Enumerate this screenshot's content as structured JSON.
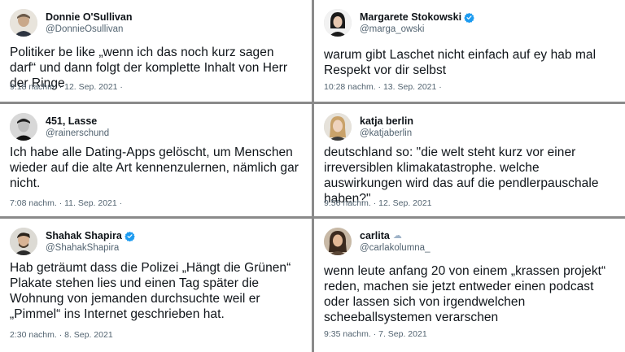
{
  "tweets": [
    {
      "name": "Donnie O'Sullivan",
      "handle": "@DonnieOsullivan",
      "verified": false,
      "text": "Politiker be like „wenn ich das noch kurz sagen darf“ und dann folgt der komplette Inhalt von Herr der Ringe",
      "meta": "9:18 nachm. · 12. Sep. 2021 ·"
    },
    {
      "name": "Margarete Stokowski",
      "handle": "@marga_owski",
      "verified": true,
      "text": "warum gibt Laschet nicht einfach auf ey hab mal Respekt vor dir selbst",
      "meta": "10:28 nachm. · 13. Sep. 2021 ·"
    },
    {
      "name": "451, Lasse",
      "handle": "@rainerschund",
      "verified": false,
      "text": "Ich habe alle Dating-Apps gelöscht, um Menschen wieder auf die alte Art kennenzulernen, nämlich gar nicht.",
      "meta": "7:08 nachm. · 11. Sep. 2021 ·"
    },
    {
      "name": "katja berlin",
      "handle": "@katjaberlin",
      "verified": false,
      "text": "deutschland so: \"die welt steht kurz vor einer irreversiblen klimakatastrophe. welche auswirkungen wird das auf die pendlerpauschale haben?\"",
      "meta": "9:56 nachm. · 12. Sep. 2021"
    },
    {
      "name": "Shahak Shapira",
      "handle": "@ShahakShapira",
      "verified": true,
      "text": "Hab geträumt dass die Polizei „Hängt die Grünen“ Plakate stehen lies und einen Tag später die Wohnung von jemanden durchsuchte weil er „Pimmel“ ins Internet geschrieben hat.",
      "meta": "2:30 nachm. · 8. Sep. 2021"
    },
    {
      "name": "carlita",
      "handle": "@carlakolumna_",
      "verified": false,
      "name_suffix": "☁",
      "text": "wenn leute anfang 20 von einem „krassen projekt“ reden, machen sie jetzt entweder einen podcast oder lassen sich von irgendwelchen scheeballsystemen verarschen",
      "meta": "9:35 nachm. · 7. Sep. 2021"
    }
  ],
  "colors": {
    "text": "#0f1419",
    "secondary": "#536471",
    "verified": "#1d9bf0",
    "divider": "#8a8a8a"
  },
  "icons": {
    "verified": "verified-badge-icon",
    "cloud": "cloud-emoji-icon"
  }
}
